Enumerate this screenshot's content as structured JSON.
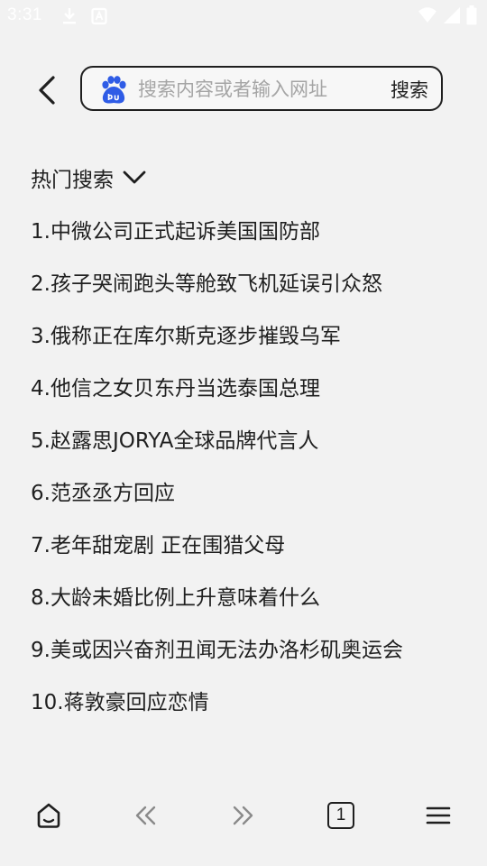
{
  "status_bar": {
    "time": "3:31",
    "icons": [
      "download-icon",
      "notification-a-icon",
      "wifi-icon",
      "signal-icon",
      "battery-icon"
    ]
  },
  "search": {
    "placeholder": "搜索内容或者输入网址",
    "submit_label": "搜索",
    "engine_logo": "baidu-paw-icon"
  },
  "hot_search": {
    "title": "热门搜索",
    "items": [
      "1.中微公司正式起诉美国国防部",
      "2.孩子哭闹跑头等舱致飞机延误引众怒",
      "3.俄称正在库尔斯克逐步摧毁乌军",
      "4.他信之女贝东丹当选泰国总理",
      "5.赵露思JORYA全球品牌代言人",
      "6.范丞丞方回应",
      "7.老年甜宠剧 正在围猎父母",
      "8.大龄未婚比例上升意味着什么",
      "9.美或因兴奋剂丑闻无法办洛杉矶奥运会",
      "10.蒋敦豪回应恋情"
    ]
  },
  "bottom_nav": {
    "tab_count": "1",
    "icons": [
      "home-icon",
      "back-double-chevron-icon",
      "forward-double-chevron-icon",
      "tabs-icon",
      "menu-icon"
    ]
  },
  "colors": {
    "background": "#f2f2f2",
    "text": "#1f1f1f",
    "placeholder": "#a5a5a5",
    "baidu_blue": "#2f5ce6",
    "nav_disabled": "#8a8a8a"
  }
}
